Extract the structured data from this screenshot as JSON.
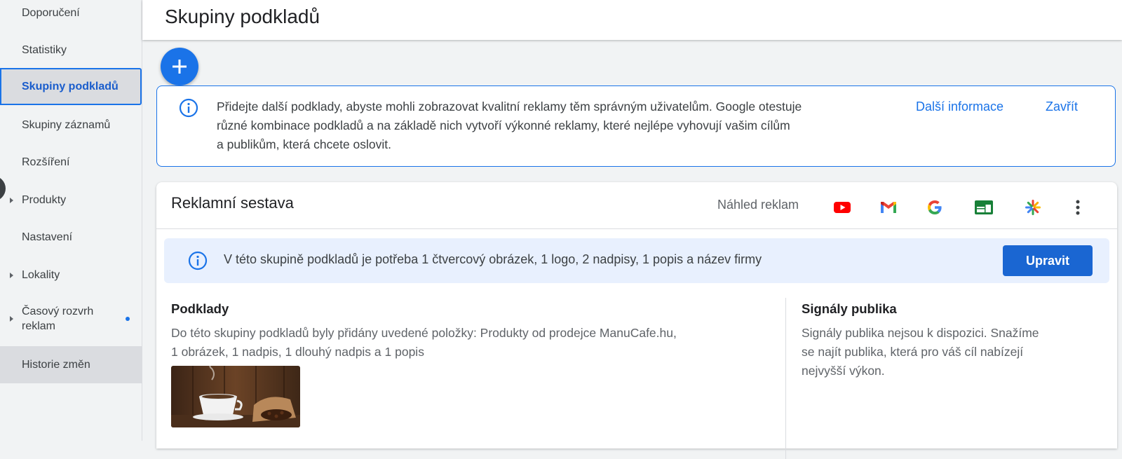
{
  "sidebar": {
    "items": [
      {
        "label": "Doporučení",
        "has_caret": false
      },
      {
        "label": "Statistiky",
        "has_caret": false
      },
      {
        "label": "Skupiny podkladů",
        "has_caret": false,
        "active": true
      },
      {
        "label": "Skupiny záznamů",
        "has_caret": false
      },
      {
        "label": "Rozšíření",
        "has_caret": false
      },
      {
        "label": "Produkty",
        "has_caret": true
      },
      {
        "label": "Nastavení",
        "has_caret": false
      },
      {
        "label": "Lokality",
        "has_caret": true
      },
      {
        "label": "Časový rozvrh reklam",
        "line1": "Časový rozvrh",
        "line2": "reklam",
        "has_caret": true,
        "has_dot": true
      },
      {
        "label": "Historie změn",
        "has_caret": false
      }
    ]
  },
  "header": {
    "title": "Skupiny podkladů"
  },
  "fab": {
    "icon": "plus-icon"
  },
  "banner": {
    "text_line1": "Přidejte další podklady, abyste mohli zobrazovat kvalitní reklamy těm správným uživatelům. Google otestuje",
    "text_line2": "různé kombinace podkladů a na základě nich vytvoří výkonné reklamy, které nejlépe vyhovují vašim cílům",
    "text_line3": "a publikům, která chcete oslovit.",
    "learn_more": "Další informace",
    "close": "Zavřít",
    "icon": "info-icon"
  },
  "card": {
    "title": "Reklamní sestava",
    "preview_label": "Náhled reklam",
    "channel_icons": [
      "youtube-icon",
      "gmail-icon",
      "google-icon",
      "display-icon",
      "discover-icon",
      "more-vert-icon"
    ],
    "requirement": {
      "text": "V této skupině podkladů je potřeba 1 čtvercový obrázek, 1 logo, 2 nadpisy, 1 popis a název firmy",
      "button": "Upravit"
    },
    "assets": {
      "title": "Podklady",
      "line1": "Do této skupiny podkladů byly přidány uvedené položky: Produkty od prodejce ManuCafe.hu,",
      "line2": "1 obrázek, 1 nadpis, 1 dlouhý nadpis a 1 popis"
    },
    "signals": {
      "title": "Signály publika",
      "line1": "Signály publika nejsou k dispozici. Snažíme",
      "line2": "se najít publika, která pro váš cíl nabízejí",
      "line3": "nejvyšší výkon."
    }
  },
  "colors": {
    "accent": "#1a73e8",
    "active_nav_bg": "#dadce0",
    "req_bg": "#e8f0fe"
  }
}
